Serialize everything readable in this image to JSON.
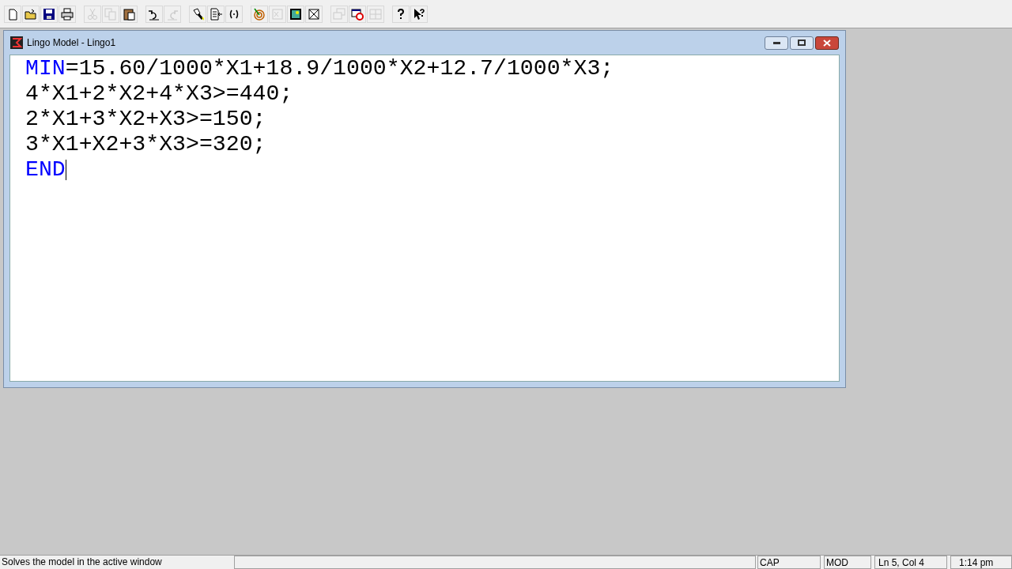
{
  "toolbar": [
    [
      {
        "kind": "new",
        "disabled": false
      },
      {
        "kind": "open",
        "disabled": false
      },
      {
        "kind": "save",
        "disabled": false
      },
      {
        "kind": "print",
        "disabled": false
      }
    ],
    [
      {
        "kind": "cut",
        "disabled": true
      },
      {
        "kind": "copy",
        "disabled": true
      },
      {
        "kind": "paste",
        "disabled": false
      }
    ],
    [
      {
        "kind": "undo",
        "disabled": false
      },
      {
        "kind": "redo",
        "disabled": true
      }
    ],
    [
      {
        "kind": "find",
        "disabled": false
      },
      {
        "kind": "goto",
        "disabled": false
      },
      {
        "kind": "match",
        "disabled": false
      }
    ],
    [
      {
        "kind": "solve",
        "disabled": false
      },
      {
        "kind": "solution",
        "disabled": true
      },
      {
        "kind": "picture",
        "disabled": false
      },
      {
        "kind": "closeall",
        "disabled": false
      }
    ],
    [
      {
        "kind": "cascade",
        "disabled": true
      },
      {
        "kind": "stop",
        "disabled": false
      },
      {
        "kind": "tile",
        "disabled": true
      }
    ],
    [
      {
        "kind": "help",
        "disabled": false
      },
      {
        "kind": "contexthelp",
        "disabled": false
      }
    ]
  ],
  "window": {
    "title": "Lingo Model - Lingo1"
  },
  "editor": {
    "lines": [
      [
        {
          "kind": "keyword",
          "text": "MIN"
        },
        {
          "kind": "plain",
          "text": "=15.60/1000*X1+18.9/1000*X2+12.7/1000*X3;"
        }
      ],
      [
        {
          "kind": "plain",
          "text": "4*X1+2*X2+4*X3>=440;"
        }
      ],
      [
        {
          "kind": "plain",
          "text": "2*X1+3*X2+X3>=150;"
        }
      ],
      [
        {
          "kind": "plain",
          "text": "3*X1+X2+3*X3>=320;"
        }
      ],
      [
        {
          "kind": "keyword",
          "text": "END"
        }
      ]
    ]
  },
  "status_bar": {
    "message": "Solves the model in the active window",
    "caps": "CAP",
    "mode": "MOD",
    "position": "Ln 5, Col 4",
    "time": "1:14 pm"
  }
}
